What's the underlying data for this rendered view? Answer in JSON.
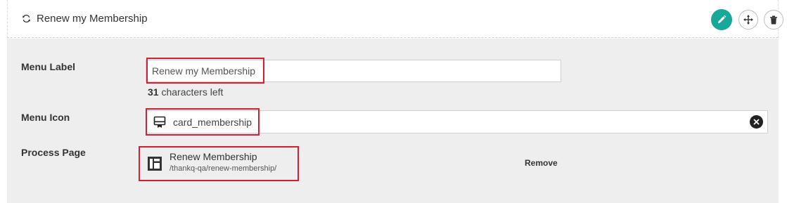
{
  "header": {
    "title": "Renew my Membership",
    "icons": [
      "refresh-icon",
      "pencil-icon",
      "move-icon",
      "trash-icon"
    ],
    "accent_color": "#17a89a"
  },
  "menu_label": {
    "label": "Menu Label",
    "value": "Renew my Membership",
    "chars_left_count": "31",
    "chars_left_text": "characters left"
  },
  "menu_icon": {
    "label": "Menu Icon",
    "value": "card_membership",
    "icon": "card-membership-icon"
  },
  "process_page": {
    "label": "Process Page",
    "title": "Renew Membership",
    "path": "/thankq-qa/renew-membership/",
    "icon": "page-layout-icon",
    "remove_label": "Remove"
  },
  "highlight_color": "#d32030"
}
